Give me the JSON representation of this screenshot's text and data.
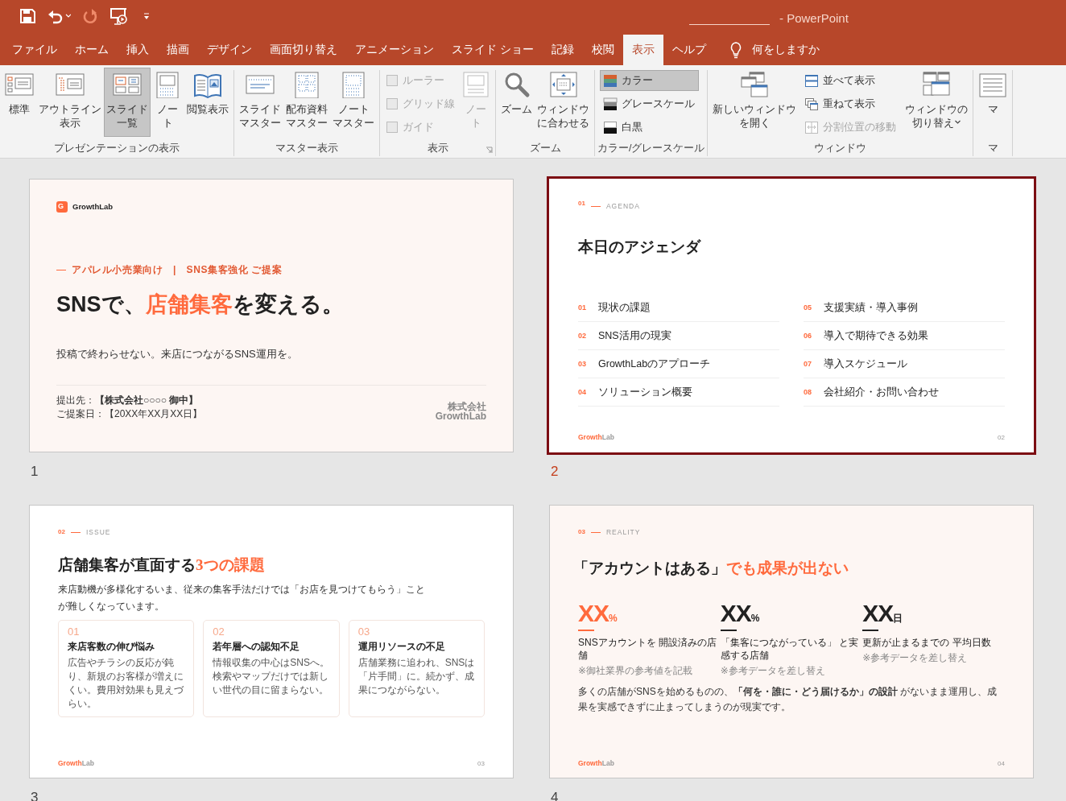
{
  "window": {
    "title": "-  PowerPoint"
  },
  "tabs": [
    {
      "label": "ファイル",
      "selected": false
    },
    {
      "label": "ホーム",
      "selected": false
    },
    {
      "label": "挿入",
      "selected": false
    },
    {
      "label": "描画",
      "selected": false
    },
    {
      "label": "デザイン",
      "selected": false
    },
    {
      "label": "画面切り替え",
      "selected": false
    },
    {
      "label": "アニメーション",
      "selected": false
    },
    {
      "label": "スライド ショー",
      "selected": false
    },
    {
      "label": "記録",
      "selected": false
    },
    {
      "label": "校閲",
      "selected": false
    },
    {
      "label": "表示",
      "selected": true
    },
    {
      "label": "ヘルプ",
      "selected": false
    }
  ],
  "tell_me": {
    "label": "何をしますか"
  },
  "ribbon": {
    "groups": [
      {
        "label": "プレゼンテーションの表示",
        "items": [
          {
            "kind": "large",
            "label": "標準",
            "selected": false
          },
          {
            "kind": "large",
            "label": "アウトライン表示",
            "selected": false
          },
          {
            "kind": "large",
            "label": "スライド一覧",
            "selected": true
          },
          {
            "kind": "large",
            "label": "ノート",
            "selected": false
          },
          {
            "kind": "large",
            "label": "閲覧表示",
            "selected": false
          }
        ]
      },
      {
        "label": "マスター表示",
        "items": [
          {
            "kind": "large",
            "label": "スライドマスター"
          },
          {
            "kind": "large",
            "label": "配布資料マスター"
          },
          {
            "kind": "large",
            "label": "ノートマスター"
          }
        ]
      },
      {
        "label": "表示",
        "launcher": true,
        "items": [
          {
            "kind": "check",
            "label": "ルーラー",
            "checked": false,
            "disabled": true
          },
          {
            "kind": "check",
            "label": "グリッド線",
            "checked": false,
            "disabled": true
          },
          {
            "kind": "check",
            "label": "ガイド",
            "checked": false,
            "disabled": true
          },
          {
            "kind": "large",
            "label": "ノート",
            "disabled": true
          }
        ]
      },
      {
        "label": "ズーム",
        "items": [
          {
            "kind": "large",
            "label": "ズーム"
          },
          {
            "kind": "large",
            "label": "ウィンドウに合わせる"
          }
        ]
      },
      {
        "label": "カラー/グレースケール",
        "items": [
          {
            "kind": "small",
            "label": "カラー",
            "selected": true
          },
          {
            "kind": "small",
            "label": "グレースケール",
            "selected": false
          },
          {
            "kind": "small",
            "label": "白黒",
            "selected": false
          }
        ]
      },
      {
        "label": "ウィンドウ",
        "items": [
          {
            "kind": "large",
            "label": "新しいウィンドウを開く",
            "disabled": false
          },
          {
            "kind": "small",
            "label": "並べて表示",
            "disabled": false
          },
          {
            "kind": "small",
            "label": "重ねて表示",
            "disabled": false
          },
          {
            "kind": "small",
            "label": "分割位置の移動",
            "disabled": true
          },
          {
            "kind": "large",
            "label": "ウィンドウの切り替え",
            "dropdown": true,
            "disabled": false
          }
        ]
      },
      {
        "label": "マ",
        "items": [
          {
            "kind": "large",
            "label": "マ"
          }
        ]
      }
    ]
  },
  "slides": [
    {
      "number": "1",
      "selected": false,
      "tinted": true,
      "kind": "title",
      "logo_letter": "G",
      "brand": "GrowthLab",
      "eyebrow": "アパレル小売業向け　|　SNS集客強化 ご提案",
      "title": [
        {
          "text": "SNSで、",
          "accent": false
        },
        {
          "text": "店舗集客",
          "accent": true
        },
        {
          "text": "を変える。",
          "accent": false
        }
      ],
      "subtitle": "投稿で終わらせない。来店につながるSNS運用を。",
      "meta": [
        "提出先：**【株式会社○○○○ 御中】**",
        "ご提案日：【20XX年XX月XX日】"
      ],
      "company": "株式会社\nGrowthLab"
    },
    {
      "number": "2",
      "selected": true,
      "tinted": false,
      "kind": "agenda",
      "section_number": "01",
      "section_label": "AGENDA",
      "title": [
        {
          "text": "本日のアジェンダ",
          "accent": false
        }
      ],
      "items": [
        {
          "num": "01",
          "text": "現状の課題"
        },
        {
          "num": "02",
          "text": "SNS活用の現実"
        },
        {
          "num": "03",
          "text": "GrowthLabのアプローチ"
        },
        {
          "num": "04",
          "text": "ソリューション概要"
        },
        {
          "num": "05",
          "text": "支援実績・導入事例"
        },
        {
          "num": "06",
          "text": "導入で期待できる効果"
        },
        {
          "num": "07",
          "text": "導入スケジュール"
        },
        {
          "num": "08",
          "text": "会社紹介・お問い合わせ"
        }
      ],
      "footer_brand": {
        "accent": "Growth",
        "rest": "Lab"
      },
      "page": "02"
    },
    {
      "number": "3",
      "selected": false,
      "tinted": false,
      "kind": "issue",
      "section_number": "02",
      "section_label": "ISSUE",
      "title": [
        {
          "text": "店舗集客が直面する",
          "accent": false
        },
        {
          "text": "3つの課題",
          "accent": true
        }
      ],
      "lead": "来店動機が多様化するいま、従来の集客手法だけでは「お店を見つけてもらう」ことが難しくなっています。",
      "cards": [
        {
          "num": "01",
          "title": "来店客数の伸び悩み",
          "body": "広告やチラシの反応が鈍り、新規のお客様が増えにくい。費用対効果も見えづらい。"
        },
        {
          "num": "02",
          "title": "若年層への認知不足",
          "body": "情報収集の中心はSNSへ。検索やマップだけでは新しい世代の目に留まらない。"
        },
        {
          "num": "03",
          "title": "運用リソースの不足",
          "body": "店舗業務に追われ、SNSは「片手間」に。続かず、成果につながらない。"
        }
      ],
      "footer_brand": {
        "accent": "Growth",
        "rest": "Lab"
      },
      "page": "03"
    },
    {
      "number": "4",
      "selected": false,
      "tinted": true,
      "kind": "reality",
      "section_number": "03",
      "section_label": "REALITY",
      "title": [
        {
          "text": "「アカウントはある」",
          "accent": false
        },
        {
          "text": "でも成果が出ない",
          "accent": true
        }
      ],
      "stats": [
        {
          "value": "XX",
          "unit": "%",
          "accent": true,
          "label": "SNSアカウントを 開設済みの店舗",
          "note": "※御社業界の参考値を記載"
        },
        {
          "value": "XX",
          "unit": "%",
          "accent": false,
          "label": "「集客につながっている」 と実感する店舗",
          "note": "※参考データを差し替え"
        },
        {
          "value": "XX",
          "unit": "日",
          "accent": false,
          "label": "更新が止まるまでの 平均日数",
          "note": "※参考データを差し替え"
        }
      ],
      "summary": "多くの店舗がSNSを始めるものの、**「何を・誰に・どう届けるか」の設計** がないまま運用し、成果を実感できずに止まってしまうのが現実です。",
      "footer_brand": {
        "accent": "Growth",
        "rest": "Lab"
      },
      "page": "04"
    }
  ]
}
